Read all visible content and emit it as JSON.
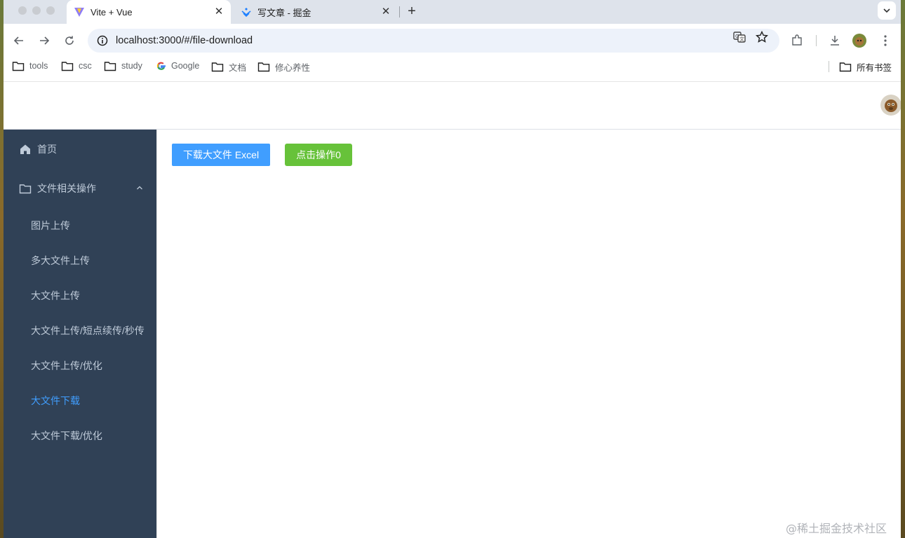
{
  "browser": {
    "tabs": [
      {
        "title": "Vite + Vue",
        "icon": "vite-icon",
        "active": true
      },
      {
        "title": "写文章 - 掘金",
        "icon": "juejin-icon",
        "active": false
      }
    ],
    "new_tab": "+",
    "close": "✕",
    "url": "localhost:3000/#/file-download",
    "bookmarks": [
      {
        "label": "tools",
        "icon": "folder-icon"
      },
      {
        "label": "csc",
        "icon": "folder-icon"
      },
      {
        "label": "study",
        "icon": "folder-icon"
      },
      {
        "label": "Google",
        "icon": "google-icon"
      },
      {
        "label": "文档",
        "icon": "folder-icon"
      },
      {
        "label": "修心养性",
        "icon": "folder-icon"
      }
    ],
    "all_bookmarks": "所有书签"
  },
  "sidebar": {
    "home": "首页",
    "file_ops": "文件相关操作",
    "items": [
      {
        "label": "图片上传"
      },
      {
        "label": "多大文件上传"
      },
      {
        "label": "大文件上传"
      },
      {
        "label": "大文件上传/短点续传/秒传"
      },
      {
        "label": "大文件上传/优化"
      },
      {
        "label": "大文件下载",
        "active": true
      },
      {
        "label": "大文件下载/优化"
      }
    ],
    "colors": {
      "background": "#304156",
      "text": "#bfcbd9",
      "active": "#409eff"
    }
  },
  "main": {
    "download_button": "下载大文件 Excel",
    "click_button": "点击操作0",
    "colors": {
      "primary": "#409eff",
      "success": "#67c23a"
    }
  },
  "watermark": "@稀土掘金技术社区"
}
